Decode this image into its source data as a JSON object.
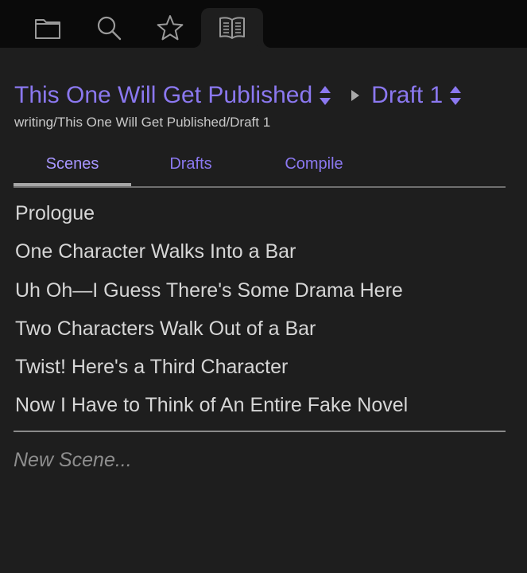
{
  "toolbar": {
    "tabs": [
      {
        "icon": "folder-icon",
        "active": false
      },
      {
        "icon": "search-icon",
        "active": false
      },
      {
        "icon": "star-icon",
        "active": false
      },
      {
        "icon": "book-icon",
        "active": true
      }
    ]
  },
  "header": {
    "project": "This One Will Get Published",
    "draft": "Draft 1",
    "path": "writing/This One Will Get Published/Draft 1"
  },
  "subtabs": [
    "Scenes",
    "Drafts",
    "Compile"
  ],
  "selected_subtab": "Scenes",
  "scenes": [
    "Prologue",
    "One Character Walks Into a Bar",
    "Uh Oh—I Guess There's Some Drama Here",
    "Two Characters Walk Out of a Bar",
    "Twist! Here's a Third Character",
    "Now I Have to Think of An Entire Fake Novel"
  ],
  "new_scene": {
    "value": "",
    "placeholder": "New Scene..."
  },
  "colors": {
    "accent": "#8b78f0",
    "background": "#1e1e1e",
    "toolbar": "#0a0a0a",
    "text": "#d6d6d6"
  }
}
